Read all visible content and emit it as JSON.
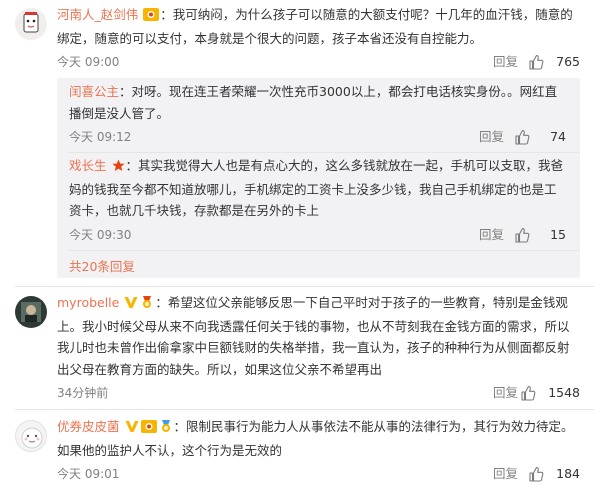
{
  "comments": [
    {
      "username": "河南人_赵剑伟",
      "text": "：我可纳闷，为什么孩子可以随意的大额支付呢？十几年的血汗钱，随意的绑定，随意的可以支付，本身就是个很大的问题，孩子本省还没有自控能力。",
      "time": "今天 09:00",
      "reply_label": "回复",
      "likes": "765"
    },
    {
      "username": "myrobelle",
      "text": "：希望这位父亲能够反思一下自己平时对于孩子的一些教育，特别是金钱观上。我小时候父母从来不向我透露任何关于钱的事物，也从不苛刻我在金钱方面的需求，所以我儿时也未曾作出偷拿家中巨额钱财的失格举措，我一直认为，孩子的种种行为从侧面都反射出父母在教育方面的缺失。所以，如果这位父亲不希望再出",
      "time": "34分钟前",
      "reply_label": "回复",
      "likes": "1548"
    },
    {
      "username": "优券皮皮菌",
      "text": "：限制民事行为能力人从事依法不能从事的法律行为，其行为效力待定。如果他的监护人不认，这个行为是无效的",
      "time": "今天 09:01",
      "reply_label": "回复",
      "likes": "184"
    }
  ],
  "sub_replies": [
    {
      "username": "闰喜公主",
      "text": "：对呀。现在连王者荣耀一次性充币3000以上，都会打电话核实身份。。网红直播倒是没人管了。",
      "time": "今天 09:12",
      "reply_label": "回复",
      "likes": "74"
    },
    {
      "username": "戏长生",
      "text": "：其实我觉得大人也是有点心大的，这么多钱就放在一起，手机可以支取，我爸妈的钱我至今都不知道放哪儿，手机绑定的工资卡上没多少钱，我自己手机绑定的也是工资卡，也就几千块钱，存款都是在另外的卡上",
      "time": "今天 09:30",
      "reply_label": "回复",
      "likes": "15"
    }
  ],
  "more_replies": "共20条回复",
  "colors": {
    "username": "#eb7350",
    "meta": "#808080",
    "reply_panel": "#f2f2f5"
  }
}
